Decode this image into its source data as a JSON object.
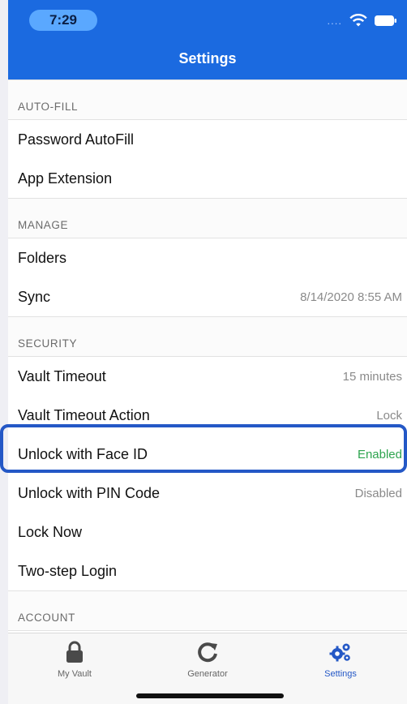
{
  "status": {
    "time": "7:29"
  },
  "header": {
    "title": "Settings"
  },
  "sections": {
    "autofill": {
      "header": "AUTO-FILL",
      "items": [
        {
          "label": "Password AutoFill"
        },
        {
          "label": "App Extension"
        }
      ]
    },
    "manage": {
      "header": "MANAGE",
      "items": [
        {
          "label": "Folders"
        },
        {
          "label": "Sync",
          "value": "8/14/2020 8:55 AM"
        }
      ]
    },
    "security": {
      "header": "SECURITY",
      "items": [
        {
          "label": "Vault Timeout",
          "value": "15 minutes"
        },
        {
          "label": "Vault Timeout Action",
          "value": "Lock"
        },
        {
          "label": "Unlock with Face ID",
          "value": "Enabled"
        },
        {
          "label": "Unlock with PIN Code",
          "value": "Disabled"
        },
        {
          "label": "Lock Now"
        },
        {
          "label": "Two-step Login"
        }
      ]
    },
    "account": {
      "header": "ACCOUNT"
    }
  },
  "tabbar": {
    "tabs": [
      {
        "label": "My Vault",
        "icon": "lock-icon"
      },
      {
        "label": "Generator",
        "icon": "refresh-icon"
      },
      {
        "label": "Settings",
        "icon": "gears-icon"
      }
    ]
  },
  "colors": {
    "accent": "#2458c6",
    "enabled": "#2ea44f",
    "header": "#1b6ae0"
  }
}
